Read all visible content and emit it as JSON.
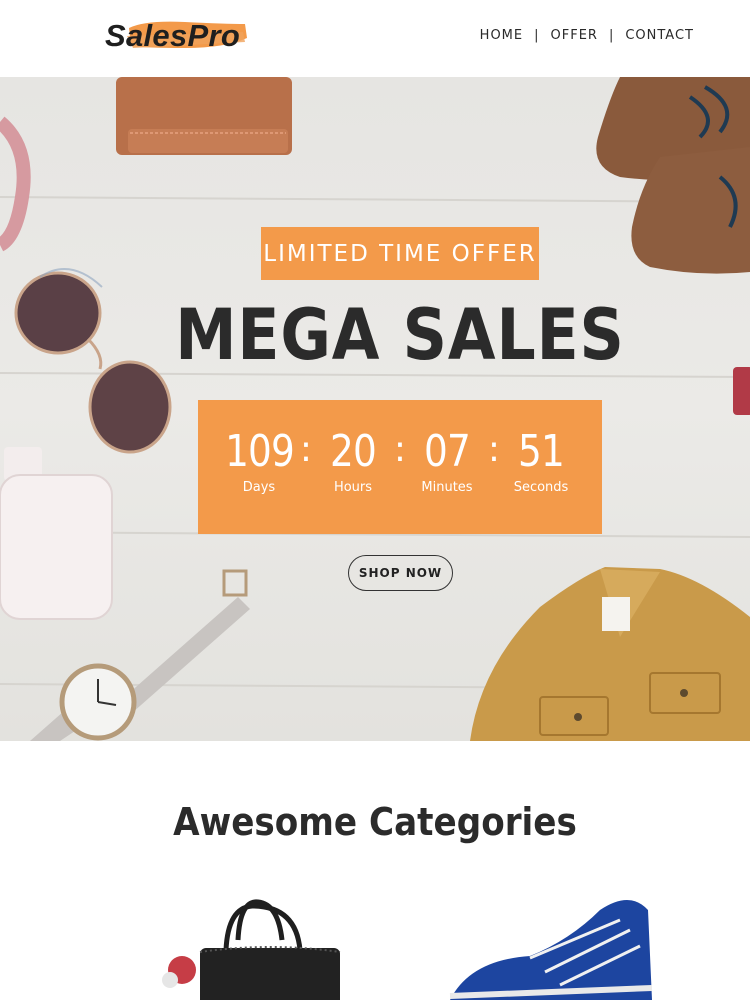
{
  "header": {
    "logo_text": "SalesPro",
    "nav": [
      "HOME",
      "OFFER",
      "CONTACT"
    ],
    "nav_separator": "|"
  },
  "hero": {
    "tag": "LIMITED TIME OFFER",
    "title": "MEGA SALES",
    "countdown": [
      {
        "value": "109",
        "label": "Days"
      },
      {
        "value": "20",
        "label": "Hours"
      },
      {
        "value": "07",
        "label": "Minutes"
      },
      {
        "value": "51",
        "label": "Seconds"
      }
    ],
    "colon": ":",
    "button": "SHOP NOW"
  },
  "categories": {
    "title": "Awesome Categories"
  },
  "colors": {
    "accent": "#f39a4a",
    "text_dark": "#2b2b2b",
    "background": "#ffffff"
  }
}
